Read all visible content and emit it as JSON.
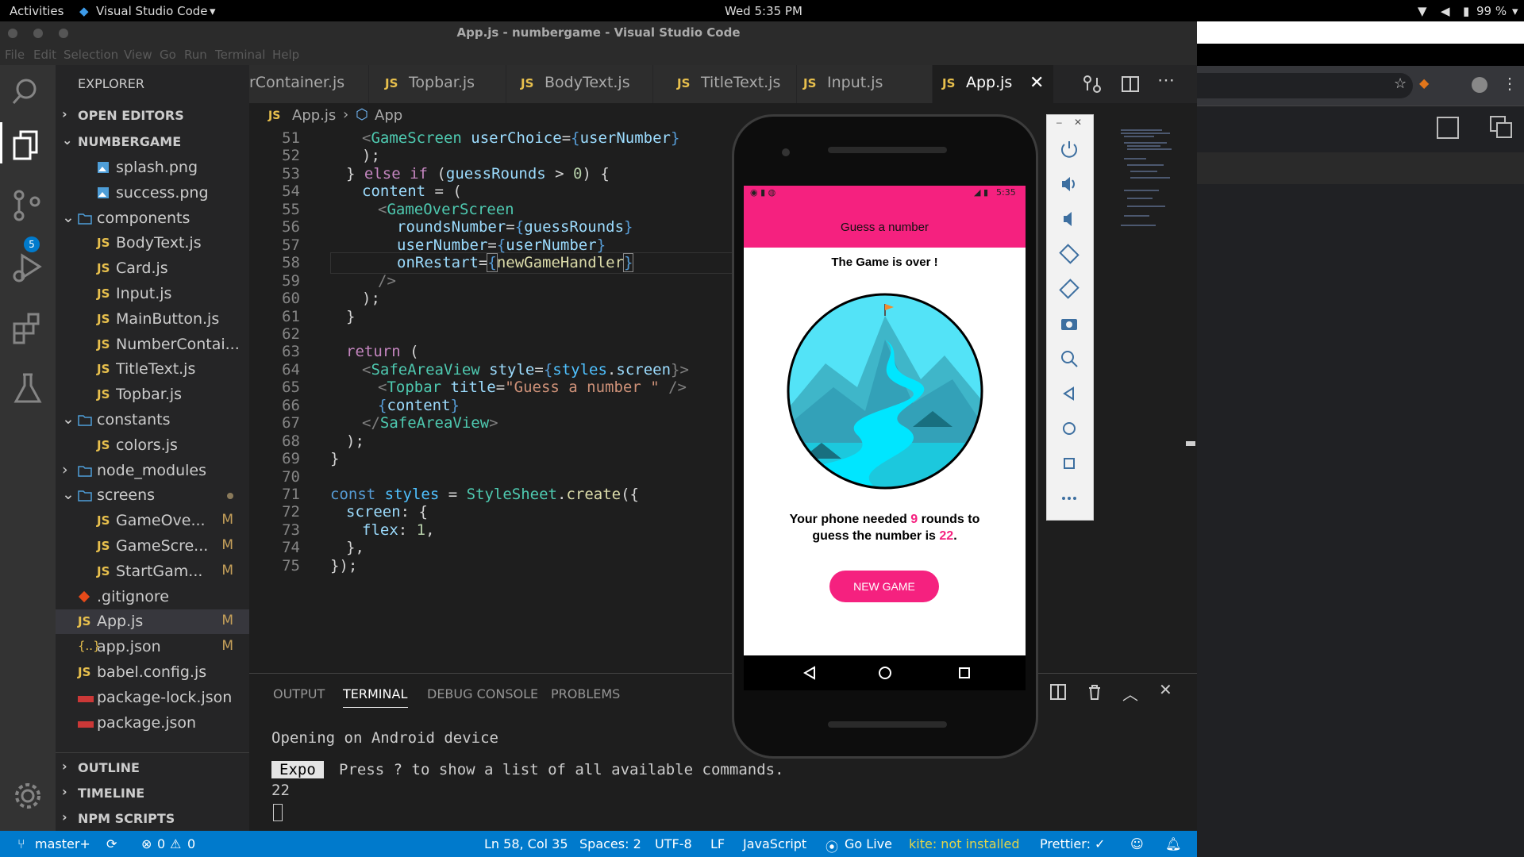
{
  "gnome": {
    "activities": "Activities",
    "app": "Visual Studio Code",
    "clock": "Wed  5:35 PM",
    "battery": "99 %"
  },
  "window": {
    "title": "App.js - numbergame - Visual Studio Code"
  },
  "menu": [
    "File",
    "Edit",
    "Selection",
    "View",
    "Go",
    "Run",
    "Terminal",
    "Help"
  ],
  "activity": {
    "scm_badge": "5"
  },
  "sidebar": {
    "title": "EXPLORER",
    "open_editors": "OPEN EDITORS",
    "project": "NUMBERGAME",
    "items": [
      {
        "label": "splash.png",
        "mod": ""
      },
      {
        "label": "success.png",
        "mod": ""
      },
      {
        "label": "components",
        "mod": ""
      },
      {
        "label": "BodyText.js",
        "mod": ""
      },
      {
        "label": "Card.js",
        "mod": ""
      },
      {
        "label": "Input.js",
        "mod": ""
      },
      {
        "label": "MainButton.js",
        "mod": ""
      },
      {
        "label": "NumberContai...",
        "mod": ""
      },
      {
        "label": "TitleText.js",
        "mod": ""
      },
      {
        "label": "Topbar.js",
        "mod": ""
      },
      {
        "label": "constants",
        "mod": ""
      },
      {
        "label": "colors.js",
        "mod": ""
      },
      {
        "label": "node_modules",
        "mod": ""
      },
      {
        "label": "screens",
        "mod": ""
      },
      {
        "label": "GameOve...",
        "mod": "M"
      },
      {
        "label": "GameScre...",
        "mod": "M"
      },
      {
        "label": "StartGam...",
        "mod": "M"
      },
      {
        "label": ".gitignore",
        "mod": ""
      },
      {
        "label": "App.js",
        "mod": "M"
      },
      {
        "label": "app.json",
        "mod": "M"
      },
      {
        "label": "babel.config.js",
        "mod": ""
      },
      {
        "label": "package-lock.json",
        "mod": ""
      },
      {
        "label": "package.json",
        "mod": ""
      }
    ],
    "outline": "OUTLINE",
    "timeline": "TIMELINE",
    "npm": "NPM SCRIPTS"
  },
  "tabs": [
    {
      "label": "rContainer.js"
    },
    {
      "label": "Topbar.js"
    },
    {
      "label": "BodyText.js"
    },
    {
      "label": "TitleText.js"
    },
    {
      "label": "Input.js"
    },
    {
      "label": "App.js"
    }
  ],
  "js_label": "JS",
  "breadcrumb": {
    "file": "App.js",
    "symbol": "App"
  },
  "line_numbers": [
    "51",
    "52",
    "53",
    "54",
    "55",
    "56",
    "57",
    "58",
    "59",
    "60",
    "61",
    "62",
    "63",
    "64",
    "65",
    "66",
    "67",
    "68",
    "69",
    "70",
    "71",
    "72",
    "73",
    "74",
    "75"
  ],
  "code": {
    "l51a": "<",
    "l51b": "GameScreen",
    "l51c": " userChoice",
    "l51d": "=",
    "l51e": "{",
    "l51f": "userNumber",
    "l51g": "}",
    "l52": ");",
    "l53a": "} ",
    "l53b": "else if",
    " l53c": "",
    "l53d": "(",
    "l53e": "guessRounds",
    "l53f": " > ",
    "l53g": "0",
    "l53h": ") {",
    "l54a": "content",
    "l54b": " = (",
    "l55a": "<",
    "l55b": "GameOverScreen",
    "l56a": "roundsNumber",
    "l56b": "=",
    "l56c": "{",
    "l56d": "guessRounds",
    "l56e": "}",
    "l57a": "userNumber",
    "l57b": "=",
    "l57c": "{",
    "l57d": "userNumber",
    "l57e": "}",
    "l58a": "onRestart",
    "l58b": "=",
    "l58c": "{",
    "l58d": "newGameHandler",
    "l58e": "}",
    "l59": "/>",
    "l60": ");",
    "l61": "}",
    "l63a": "return",
    "l63b": " (",
    "l64a": "<",
    "l64b": "SafeAreaView",
    "l64c": " style",
    "l64d": "=",
    "l64e": "{",
    "l64f": "styles",
    "l64g": ".",
    "l64h": "screen",
    "l64i": "}>",
    "l65a": "<",
    "l65b": "Topbar",
    "l65c": " title",
    "l65d": "=",
    "l65e": "\"Guess a number \"",
    "l65f": " />",
    "l66a": "{",
    "l66b": "content",
    "l66c": "}",
    "l67a": "</",
    "l67b": "SafeAreaView",
    "l67c": ">",
    "l68": ");",
    "l69": "}",
    "l71a": "const",
    "l71b": " styles",
    "l71c": " = ",
    "l71d": "StyleSheet",
    "l71e": ".",
    "l71f": "create",
    "l71g": "({",
    "l72a": "screen",
    "l72b": ": {",
    "l73a": "flex",
    "l73b": ": ",
    "l73c": "1",
    "l73d": ",",
    "l74": "},",
    "l75": "});"
  },
  "panel": {
    "tabs": [
      "OUTPUT",
      "TERMINAL",
      "DEBUG CONSOLE",
      "PROBLEMS"
    ],
    "line1": "Opening on Android device",
    "expo": "Expo",
    "line2": "Press ? to show a list of all available commands.",
    "line3": "22"
  },
  "status": {
    "branch": "master+",
    "errors": "0",
    "warnings": "0",
    "position": "Ln 58, Col 35",
    "spaces": "Spaces: 2",
    "encoding": "UTF-8",
    "eol": "LF",
    "language": "JavaScript",
    "golive": "Go Live",
    "kite": "kite: not installed",
    "prettier": "Prettier: ✓"
  },
  "phone": {
    "time": "5:35",
    "header": "Guess a number",
    "title": "The Game is over !",
    "result_prefix": "Your phone needed ",
    "rounds": "9",
    "result_mid": " rounds to",
    "result_line2": "guess the number is ",
    "number": "22",
    "period": ".",
    "button": "NEW GAME"
  },
  "colors": {
    "accent": "#f5217f",
    "statusbar": "#007acc",
    "activity": "#333333",
    "sidebar": "#252526",
    "editor": "#1e1e1e"
  }
}
